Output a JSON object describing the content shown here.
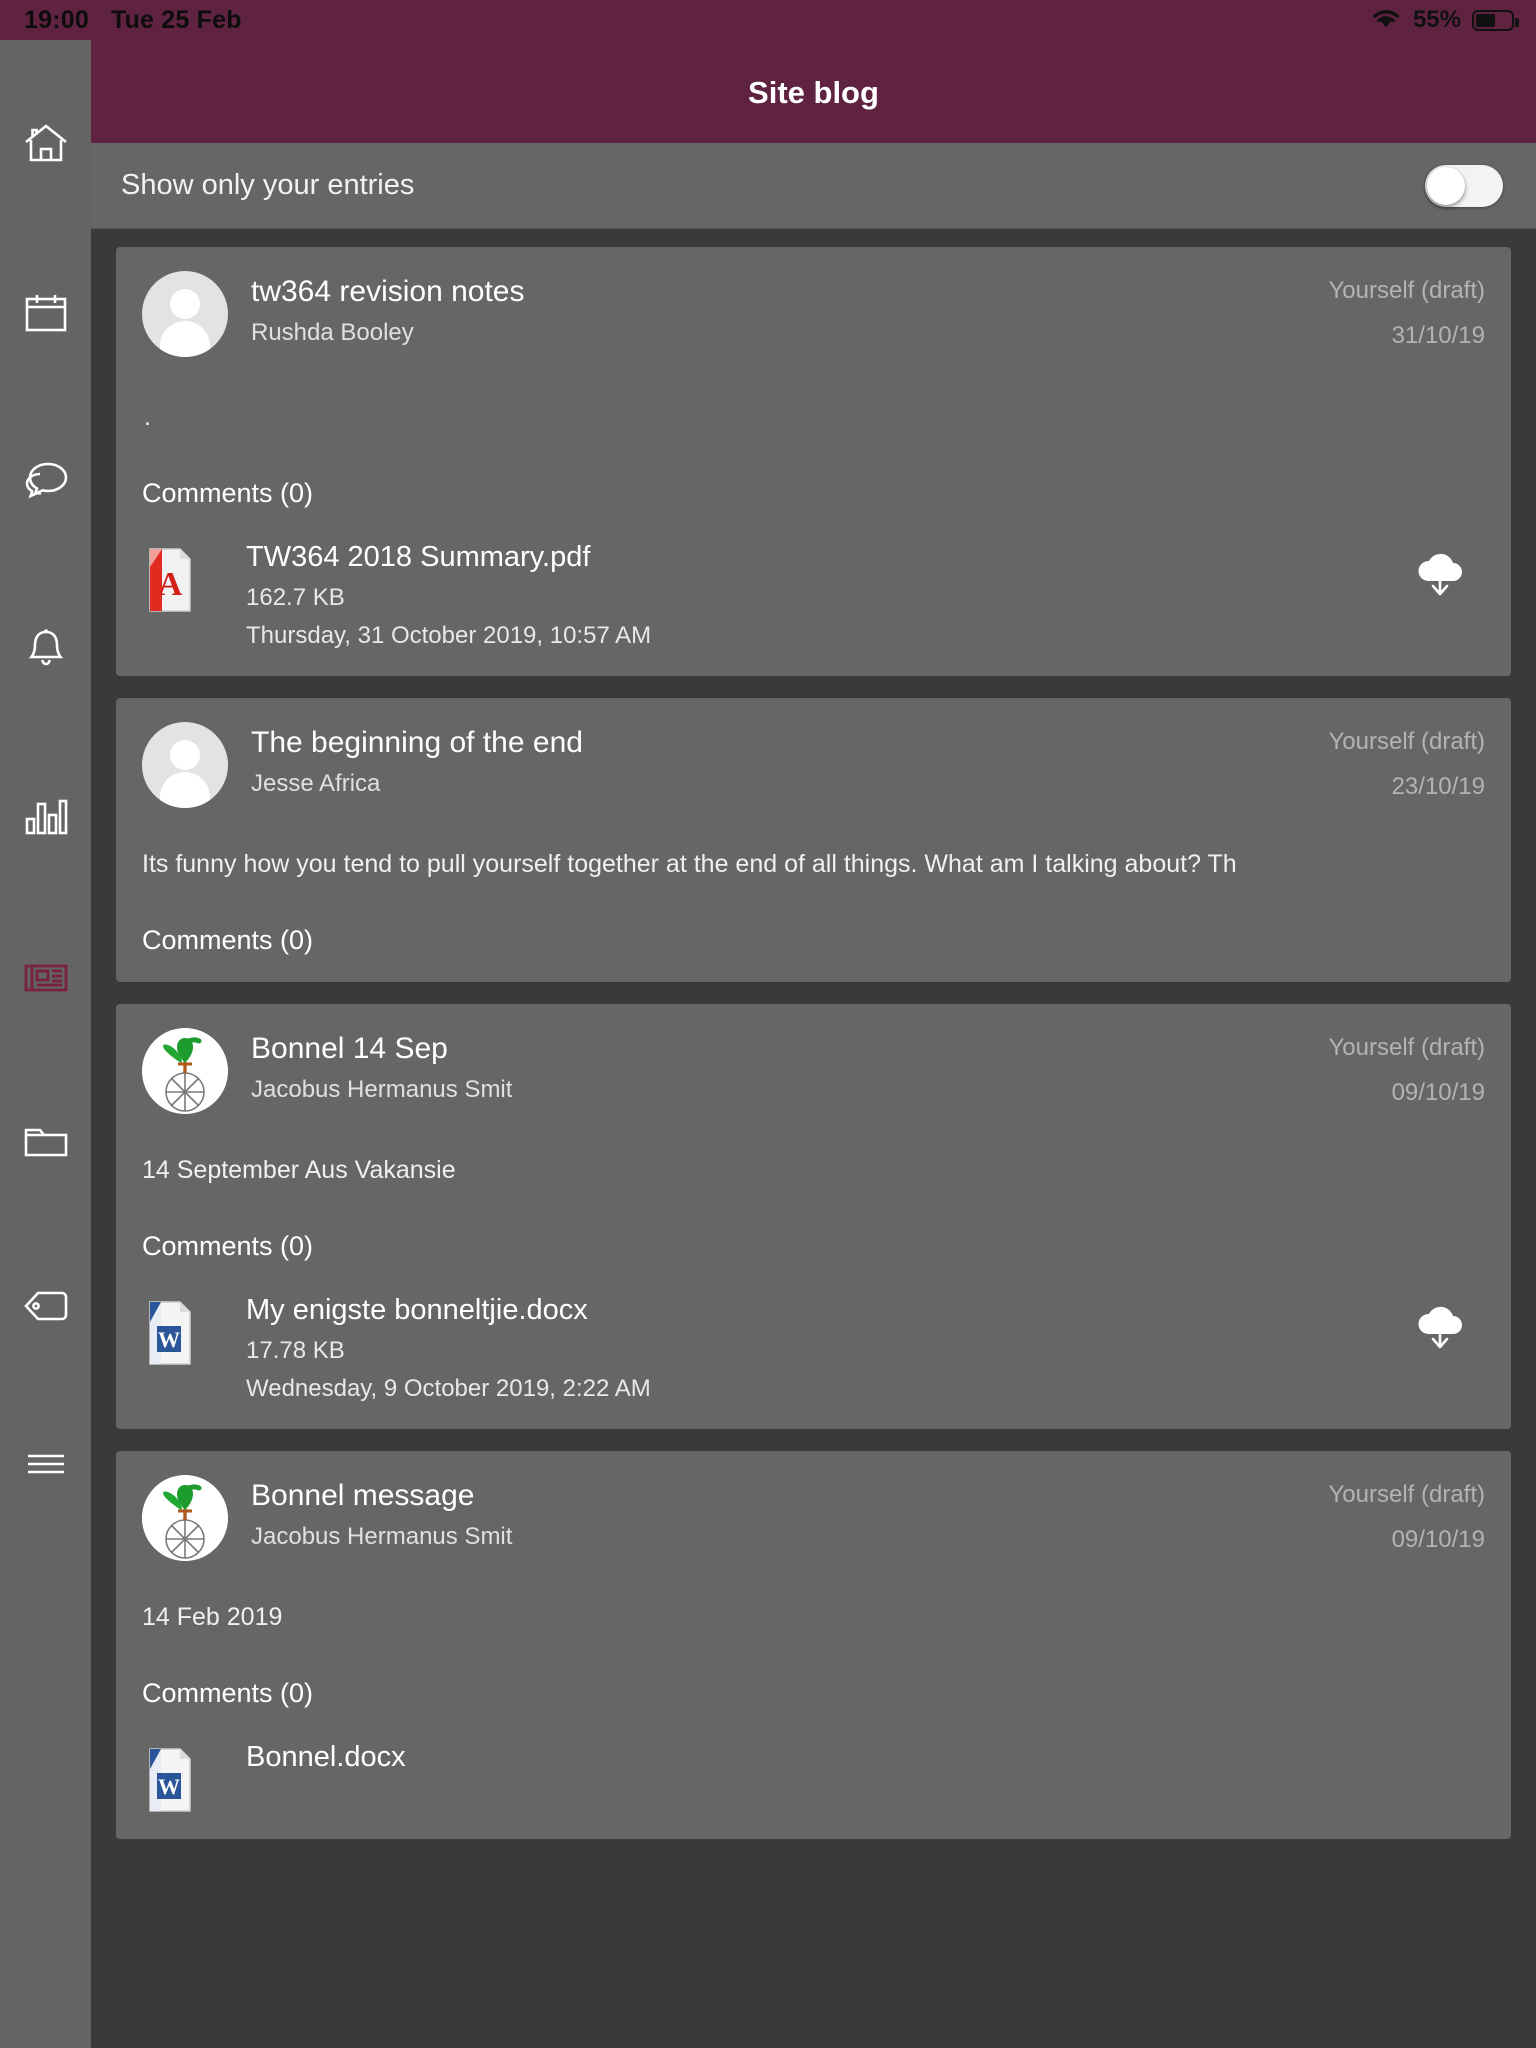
{
  "statusbar": {
    "time": "19:00",
    "date": "Tue 25 Feb",
    "battery_percent": "55%",
    "battery_level": 55,
    "wifi_icon": "wifi-icon",
    "battery_icon": "battery-icon"
  },
  "header": {
    "title": "Site blog"
  },
  "filter": {
    "label": "Show only your entries",
    "toggle_state": "off"
  },
  "sidebar": {
    "items": [
      {
        "name": "home",
        "icon": "home-icon",
        "active": false
      },
      {
        "name": "calendar",
        "icon": "calendar-icon",
        "active": false
      },
      {
        "name": "messages",
        "icon": "chat-icon",
        "active": false
      },
      {
        "name": "notifications",
        "icon": "bell-icon",
        "active": false
      },
      {
        "name": "grades",
        "icon": "bar-chart-icon",
        "active": false
      },
      {
        "name": "site-blog",
        "icon": "newspaper-icon",
        "active": true
      },
      {
        "name": "files",
        "icon": "folder-icon",
        "active": false
      },
      {
        "name": "tags",
        "icon": "tag-icon",
        "active": false
      },
      {
        "name": "menu",
        "icon": "hamburger-icon",
        "active": false
      }
    ],
    "active_color": "#7a2040",
    "icon_color": "#ffffff"
  },
  "posts": [
    {
      "title": "tw364 revision notes",
      "author": "Rushda Booley",
      "visibility": "Yourself (draft)",
      "date": "31/10/19",
      "avatar_type": "placeholder",
      "body": ".",
      "comments": "Comments (0)",
      "attachment": {
        "name": "TW364 2018 Summary.pdf",
        "size": "162.7 KB",
        "date": "Thursday, 31 October 2019, 10:57 AM",
        "type": "pdf",
        "download_icon": "cloud-download-icon"
      }
    },
    {
      "title": "The beginning of the end",
      "author": "Jesse Africa",
      "visibility": "Yourself (draft)",
      "date": "23/10/19",
      "avatar_type": "placeholder",
      "body": "Its funny how you tend to pull yourself together at the end of all things. What am I talking about? Th",
      "comments": "Comments (0)",
      "attachment": null
    },
    {
      "title": "Bonnel 14 Sep",
      "author": "Jacobus Hermanus Smit",
      "visibility": "Yourself (draft)",
      "date": "09/10/19",
      "avatar_type": "photo",
      "body": "14 September Aus Vakansie",
      "comments": "Comments (0)",
      "attachment": {
        "name": "My enigste bonneltjie.docx",
        "size": "17.78 KB",
        "date": "Wednesday, 9 October 2019, 2:22 AM",
        "type": "docx",
        "download_icon": "cloud-download-icon"
      }
    },
    {
      "title": "Bonnel message",
      "author": "Jacobus Hermanus Smit",
      "visibility": "Yourself (draft)",
      "date": "09/10/19",
      "avatar_type": "photo",
      "body": "14 Feb 2019",
      "comments": "Comments (0)",
      "attachment": {
        "name": "Bonnel.docx",
        "size": "",
        "date": "",
        "type": "docx",
        "download_icon": "cloud-download-icon"
      }
    }
  ],
  "colors": {
    "brand": "#5f2240",
    "card": "#666666",
    "page_bg": "#3a3a3a",
    "sidebar": "#646464"
  }
}
